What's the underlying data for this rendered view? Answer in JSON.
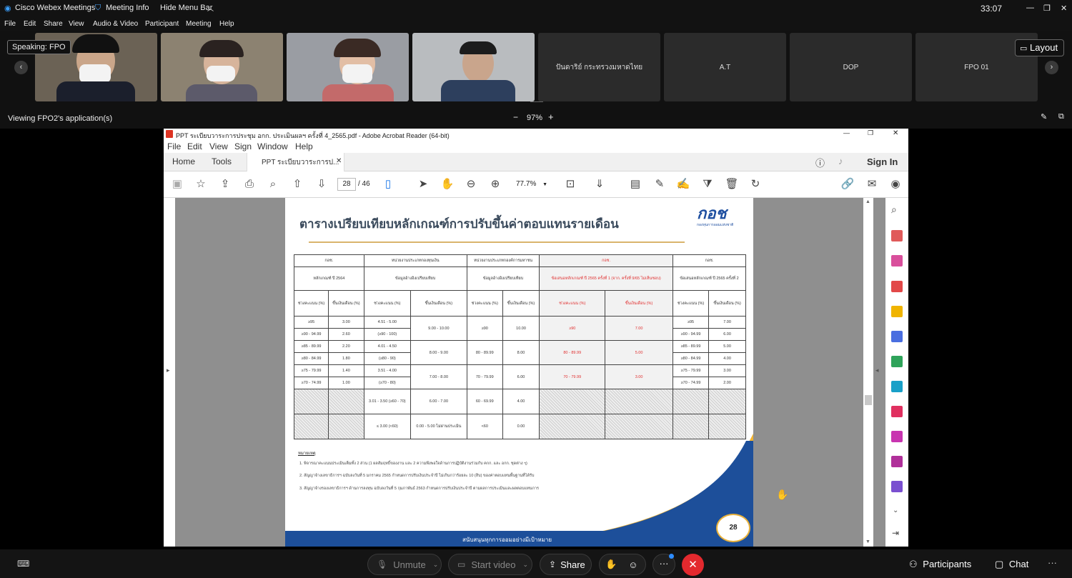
{
  "webex": {
    "app_title": "Cisco Webex Meetings",
    "meeting_info": "Meeting Info",
    "hide_menu_bar": "Hide Menu Bar",
    "timer": "33:07",
    "menu": [
      "File",
      "Edit",
      "Share",
      "View",
      "Audio & Video",
      "Participant",
      "Meeting",
      "Help"
    ],
    "speaking_label": "Speaking: FPO",
    "layout_label": "Layout",
    "participants": [
      "ปันดาริย์ กระทรวงมหาดไทย",
      "A.T",
      "DOP",
      "FPO 01"
    ],
    "viewing_label": "Viewing FPO2's application(s)",
    "zoom": {
      "minus": "−",
      "value": "97%",
      "plus": "+"
    },
    "bottom": {
      "unmute": "Unmute",
      "start_video": "Start video",
      "share": "Share",
      "participants": "Participants",
      "chat": "Chat",
      "more": "···"
    }
  },
  "acrobat": {
    "title": "PPT ระเบียบวาระการประชุม อกก. ประเมินผลฯ ครั้งที่ 4_2565.pdf - Adobe Acrobat Reader (64-bit)",
    "menu": [
      "File",
      "Edit",
      "View",
      "Sign",
      "Window",
      "Help"
    ],
    "tab_home": "Home",
    "tab_tools": "Tools",
    "tab_doc": "PPT ระเบียบวาระการป...",
    "sign_in": "Sign In",
    "page_current": "28",
    "page_total": "/ 46",
    "zoom_value": "77.7%"
  },
  "slide": {
    "title": "ตารางเปรียบเทียบหลักเกณฑ์การปรับขึ้นค่าตอบแทนรายเดือน",
    "logo_text": "กอช",
    "logo_sub": "กองทุนการออมแห่งชาติ",
    "header_groups": [
      "กอช.",
      "หน่วยงานประเภทกองทุนเงิน",
      "หน่วยงานประเภทกองค์การมหาชน",
      "กอช.",
      "กอช."
    ],
    "header_sub": [
      "หลักเกณฑ์ ปี 2564",
      "ข้อมูลอ้างอิงเปรียบเทียบ",
      "ข้อมูลอ้างอิงเปรียบเทียบ",
      "ข้อเสนอหลักเกณฑ์ ปี 2565 ครั้งที่ 1 (จาก. ครั้งที่ 9/65 ไม่เห็นชอบ)",
      "ข้อเสนอหลักเกณฑ์ ปี 2565 ครั้งที่ 2"
    ],
    "col_range": "ช่วงคะแนน (%)",
    "col_increase": "ขึ้นเงินเดือน (%)",
    "rows": [
      [
        "≥95",
        "3.00",
        "4.51 - 5.00",
        "9.00 - 10.00",
        "≥90",
        "10.00",
        "≥90",
        "7.00",
        "≥95",
        "7.00"
      ],
      [
        "≥90 - 94.99",
        "2.60",
        "(≥90 - 100)",
        "",
        "",
        "",
        "",
        "",
        "≥90 - 94.99",
        "6.00"
      ],
      [
        "≥85 - 89.99",
        "2.20",
        "4.01 - 4.50",
        "8.00 - 9.00",
        "80 - 89.99",
        "8.00",
        "80 - 89.99",
        "5.00",
        "≥85 - 89.99",
        "5.00"
      ],
      [
        "≥80 - 84.99",
        "1.80",
        "(≥80 - 90)",
        "",
        "",
        "",
        "",
        "",
        "≥80 - 84.99",
        "4.00"
      ],
      [
        "≥75 - 79.99",
        "1.40",
        "3.51 - 4.00",
        "7.00 - 8.00",
        "70 - 79.99",
        "6.00",
        "70 - 79.99",
        "3.00",
        "≥75 - 79.99",
        "3.00"
      ],
      [
        "≥70 - 74.99",
        "1.00",
        "(≥70 - 80)",
        "",
        "",
        "",
        "",
        "",
        "≥70 - 74.99",
        "2.00"
      ],
      [
        "",
        "",
        "3.01 - 3.50 (≥60 - 70)",
        "6.00 - 7.00",
        "60 - 69.99",
        "4.00",
        "",
        "",
        "",
        ""
      ],
      [
        "",
        "",
        "≤ 3.00 (<60)",
        "0.00 - 5.00 ไม่ผ่านประเมิน",
        "<60",
        "0.00",
        "",
        "",
        "",
        ""
      ]
    ],
    "notes_title": "หมายเหตุ",
    "notes": [
      "1. พิจารณาคะแนนประเมินเต็มทั้ง 2 ส่วน (1 ผลสัมฤทธิ์ของงาน และ 2 ความพึงพอใจด้านการปฏิบัติงานร่วมกับ คกก. และ อกก. ชุดต่าง ๆ)",
      "2. สัญญาจ้างเลขาธิการฯ ฉบับลงวันที่ 5 มกราคม 2565 กำหนดการปรับเงินประจำปี ไม่เกินกว่าร้อยละ 10 (สิบ) ของค่าตอบแทนพื้นฐานที่ได้รับ",
      "3. สัญญาจ้างรองเลขาธิการฯ ด้านการลงทุน ฉบับลงวันที่ 5 กุมภาพันธ์ 2563 กำหนดการปรับเงินประจำปี ตามผลการประเมินและผลตอบแทนการ"
    ],
    "footer": "สนับสนุนทุกการออมอย่างมีเป้าหมาย",
    "page_number": "28"
  }
}
